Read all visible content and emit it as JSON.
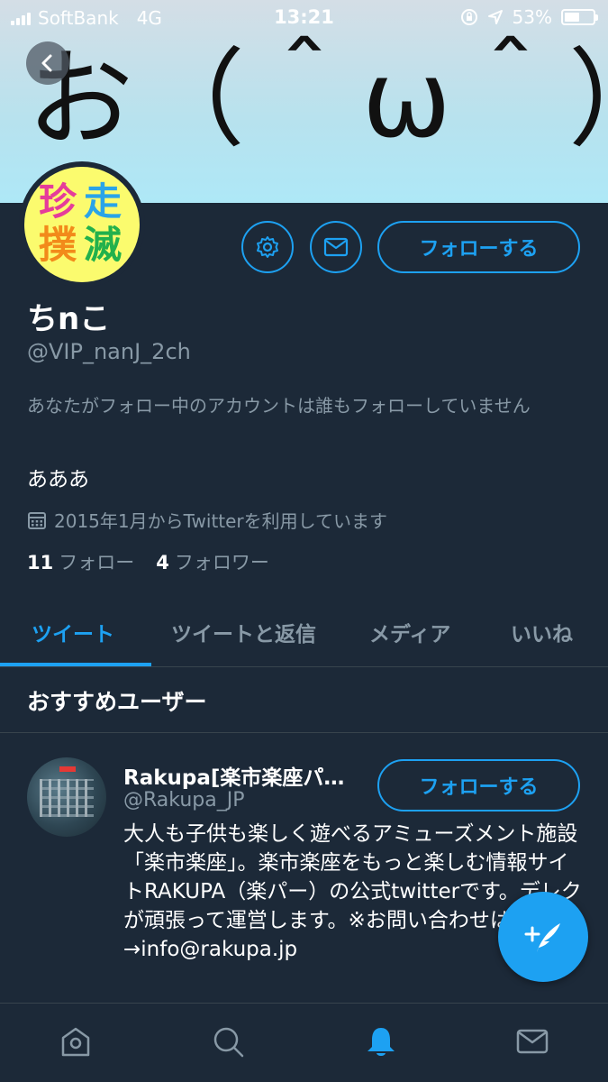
{
  "status_bar": {
    "carrier": "SoftBank",
    "network": "4G",
    "time": "13:21",
    "battery": "53%",
    "battery_level": 0.53
  },
  "banner": {
    "text": "お（＾ω＾）"
  },
  "avatar": {
    "chars": [
      "珍",
      "走",
      "撲",
      "滅"
    ],
    "bg_color": "#fbfb6e"
  },
  "profile": {
    "display_name": "ちnこ",
    "handle": "@VIP_nanJ_2ch",
    "followed_by_note": "あなたがフォロー中のアカウントは誰もフォローしていません",
    "bio": "あああ",
    "joined": "2015年1月からTwitterを利用しています",
    "following_count": "11",
    "following_label": "フォロー",
    "followers_count": "4",
    "followers_label": "フォロワー",
    "follow_button": "フォローする"
  },
  "tabs": [
    {
      "label": "ツイート",
      "active": true
    },
    {
      "label": "ツイートと返信",
      "active": false
    },
    {
      "label": "メディア",
      "active": false
    },
    {
      "label": "いいね",
      "active": false
    }
  ],
  "recommended": {
    "title": "おすすめユーザー",
    "users": [
      {
        "name": "Rakupa[楽市楽座パ…",
        "handle": "@Rakupa_JP",
        "follow_button": "フォローする",
        "bio": "大人も子供も楽しく遊べるアミューズメント施設「楽市楽座」。楽市楽座をもっと楽しむ情報サイトRAKUPA（楽パー）の公式twitterです。デレクが頑張って運営します。※お問い合わせはこちら→info@rakupa.jp"
      }
    ]
  },
  "icons": {
    "back": "back-arrow-icon",
    "settings": "gear-icon",
    "message": "envelope-icon",
    "calendar": "calendar-icon",
    "compose": "compose-tweet-icon",
    "nav": [
      "home-icon",
      "search-icon",
      "notifications-bell-icon",
      "messages-icon"
    ]
  },
  "colors": {
    "accent": "#1da1f2",
    "background": "#1c2938",
    "secondary_text": "#8899a6",
    "divider": "#38444d"
  }
}
